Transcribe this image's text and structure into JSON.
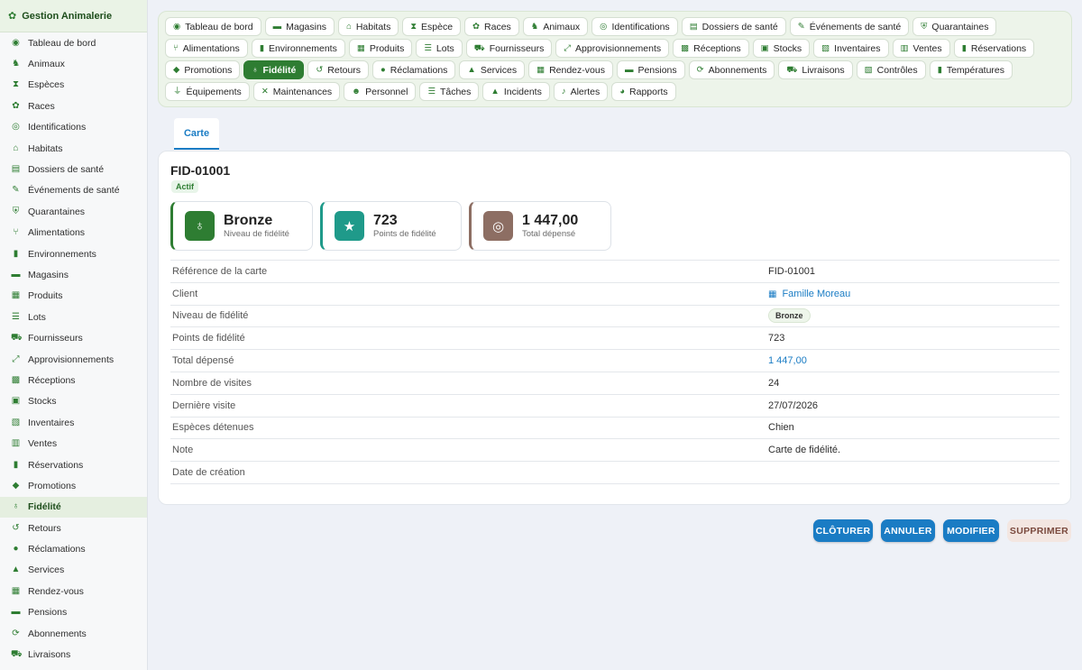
{
  "app": {
    "title": "Gestion Animalerie",
    "logo_icon": "paw-icon"
  },
  "sidebar": {
    "items": [
      {
        "label": "Tableau de bord",
        "icon": "gauge-icon",
        "glyph": "◉"
      },
      {
        "label": "Animaux",
        "icon": "horse-icon",
        "glyph": "♞"
      },
      {
        "label": "Espèces",
        "icon": "dna-icon",
        "glyph": "⧗"
      },
      {
        "label": "Races",
        "icon": "paw-icon",
        "glyph": "✿"
      },
      {
        "label": "Identifications",
        "icon": "fingerprint-icon",
        "glyph": "◎"
      },
      {
        "label": "Habitats",
        "icon": "house-icon",
        "glyph": "⌂"
      },
      {
        "label": "Dossiers de santé",
        "icon": "file-medical-icon",
        "glyph": "▤"
      },
      {
        "label": "Événements de santé",
        "icon": "syringe-icon",
        "glyph": "✎"
      },
      {
        "label": "Quarantaines",
        "icon": "shield-icon",
        "glyph": "⛨"
      },
      {
        "label": "Alimentations",
        "icon": "utensils-icon",
        "glyph": "⑂"
      },
      {
        "label": "Environnements",
        "icon": "thermometer-icon",
        "glyph": "▮"
      },
      {
        "label": "Magasins",
        "icon": "store-icon",
        "glyph": "▬"
      },
      {
        "label": "Produits",
        "icon": "box-icon",
        "glyph": "▦"
      },
      {
        "label": "Lots",
        "icon": "list-icon",
        "glyph": "☰"
      },
      {
        "label": "Fournisseurs",
        "icon": "truck-icon",
        "glyph": "⛟"
      },
      {
        "label": "Approvisionnements",
        "icon": "dolly-icon",
        "glyph": "⤢"
      },
      {
        "label": "Réceptions",
        "icon": "boxes-icon",
        "glyph": "▩"
      },
      {
        "label": "Stocks",
        "icon": "warehouse-icon",
        "glyph": "▣"
      },
      {
        "label": "Inventaires",
        "icon": "clipboard-check-icon",
        "glyph": "▧"
      },
      {
        "label": "Ventes",
        "icon": "cash-register-icon",
        "glyph": "▥"
      },
      {
        "label": "Réservations",
        "icon": "bookmark-icon",
        "glyph": "▮"
      },
      {
        "label": "Promotions",
        "icon": "tags-icon",
        "glyph": "◆"
      },
      {
        "label": "Fidélité",
        "icon": "award-icon",
        "glyph": "♁"
      },
      {
        "label": "Retours",
        "icon": "undo-icon",
        "glyph": "↺"
      },
      {
        "label": "Réclamations",
        "icon": "comment-icon",
        "glyph": "●"
      },
      {
        "label": "Services",
        "icon": "bell-concierge-icon",
        "glyph": "▲"
      },
      {
        "label": "Rendez-vous",
        "icon": "calendar-check-icon",
        "glyph": "▦"
      },
      {
        "label": "Pensions",
        "icon": "bed-icon",
        "glyph": "▬"
      },
      {
        "label": "Abonnements",
        "icon": "sync-icon",
        "glyph": "⟳"
      },
      {
        "label": "Livraisons",
        "icon": "truck-fast-icon",
        "glyph": "⛟"
      }
    ],
    "active_index": 22
  },
  "tabs": {
    "items": [
      {
        "label": "Tableau de bord",
        "icon": "gauge-icon",
        "glyph": "◉"
      },
      {
        "label": "Magasins",
        "icon": "store-icon",
        "glyph": "▬"
      },
      {
        "label": "Habitats",
        "icon": "house-icon",
        "glyph": "⌂"
      },
      {
        "label": "Espèce",
        "icon": "dna-icon",
        "glyph": "⧗"
      },
      {
        "label": "Races",
        "icon": "paw-icon",
        "glyph": "✿"
      },
      {
        "label": "Animaux",
        "icon": "horse-icon",
        "glyph": "♞"
      },
      {
        "label": "Identifications",
        "icon": "fingerprint-icon",
        "glyph": "◎"
      },
      {
        "label": "Dossiers de santé",
        "icon": "file-medical-icon",
        "glyph": "▤"
      },
      {
        "label": "Événements de santé",
        "icon": "syringe-icon",
        "glyph": "✎"
      },
      {
        "label": "Quarantaines",
        "icon": "shield-icon",
        "glyph": "⛨"
      },
      {
        "label": "Alimentations",
        "icon": "utensils-icon",
        "glyph": "⑂"
      },
      {
        "label": "Environnements",
        "icon": "thermometer-icon",
        "glyph": "▮"
      },
      {
        "label": "Produits",
        "icon": "box-icon",
        "glyph": "▦"
      },
      {
        "label": "Lots",
        "icon": "list-icon",
        "glyph": "☰"
      },
      {
        "label": "Fournisseurs",
        "icon": "truck-icon",
        "glyph": "⛟"
      },
      {
        "label": "Approvisionnements",
        "icon": "dolly-icon",
        "glyph": "⤢"
      },
      {
        "label": "Réceptions",
        "icon": "boxes-icon",
        "glyph": "▩"
      },
      {
        "label": "Stocks",
        "icon": "warehouse-icon",
        "glyph": "▣"
      },
      {
        "label": "Inventaires",
        "icon": "clipboard-check-icon",
        "glyph": "▧"
      },
      {
        "label": "Ventes",
        "icon": "cash-register-icon",
        "glyph": "▥"
      },
      {
        "label": "Réservations",
        "icon": "bookmark-icon",
        "glyph": "▮"
      },
      {
        "label": "Promotions",
        "icon": "tags-icon",
        "glyph": "◆"
      },
      {
        "label": "Fidélité",
        "icon": "award-icon",
        "glyph": "♁"
      },
      {
        "label": "Retours",
        "icon": "undo-icon",
        "glyph": "↺"
      },
      {
        "label": "Réclamations",
        "icon": "comment-icon",
        "glyph": "●"
      },
      {
        "label": "Services",
        "icon": "bell-concierge-icon",
        "glyph": "▲"
      },
      {
        "label": "Rendez-vous",
        "icon": "calendar-check-icon",
        "glyph": "▦"
      },
      {
        "label": "Pensions",
        "icon": "bed-icon",
        "glyph": "▬"
      },
      {
        "label": "Abonnements",
        "icon": "sync-icon",
        "glyph": "⟳"
      },
      {
        "label": "Livraisons",
        "icon": "truck-fast-icon",
        "glyph": "⛟"
      },
      {
        "label": "Contrôles",
        "icon": "clipboard-icon",
        "glyph": "▧"
      },
      {
        "label": "Températures",
        "icon": "thermometer-icon",
        "glyph": "▮"
      },
      {
        "label": "Équipements",
        "icon": "plug-icon",
        "glyph": "⏚"
      },
      {
        "label": "Maintenances",
        "icon": "tools-icon",
        "glyph": "✕"
      },
      {
        "label": "Personnel",
        "icon": "users-icon",
        "glyph": "☻"
      },
      {
        "label": "Tâches",
        "icon": "tasks-icon",
        "glyph": "☰"
      },
      {
        "label": "Incidents",
        "icon": "warning-icon",
        "glyph": "▲"
      },
      {
        "label": "Alertes",
        "icon": "bell-icon",
        "glyph": "♪"
      },
      {
        "label": "Rapports",
        "icon": "chart-pie-icon",
        "glyph": "◕"
      }
    ],
    "active_index": 22
  },
  "content_tab": {
    "label": "Carte"
  },
  "record": {
    "title": "FID-01001",
    "status": "Actif",
    "stats": [
      {
        "value": "Bronze",
        "label": "Niveau de fidélité",
        "icon": "award-icon",
        "glyph": "♁",
        "color": "#2e7d32"
      },
      {
        "value": "723",
        "label": "Points de fidélité",
        "icon": "star-icon",
        "glyph": "★",
        "color": "#1f9a8a"
      },
      {
        "value": "1 447,00",
        "label": "Total dépensé",
        "icon": "coins-icon",
        "glyph": "◎",
        "color": "#8d6e63"
      }
    ],
    "details": [
      {
        "label": "Référence de la carte",
        "value": "FID-01001"
      },
      {
        "label": "Client",
        "value": "Famille Moreau",
        "icon": "building-icon"
      },
      {
        "label": "Niveau de fidélité",
        "value": "Bronze"
      },
      {
        "label": "Points de fidélité",
        "value": "723"
      },
      {
        "label": "Total dépensé",
        "value": "1 447,00"
      },
      {
        "label": "Nombre de visites",
        "value": "24"
      },
      {
        "label": "Dernière visite",
        "value": "27/07/2026"
      },
      {
        "label": "Espèces détenues",
        "value": "Chien"
      },
      {
        "label": "Note",
        "value": "Carte de fidélité."
      },
      {
        "label": "Date de création",
        "value": ""
      }
    ]
  },
  "actions": {
    "close": "CLÔTURER",
    "cancel": "ANNULER",
    "edit": "MODIFIER",
    "delete": "SUPPRIMER"
  },
  "colors": {
    "brand_green": "#2e7d32",
    "link_blue": "#1a7cc4",
    "teal": "#1f9a8a",
    "brown": "#8d6e63"
  }
}
